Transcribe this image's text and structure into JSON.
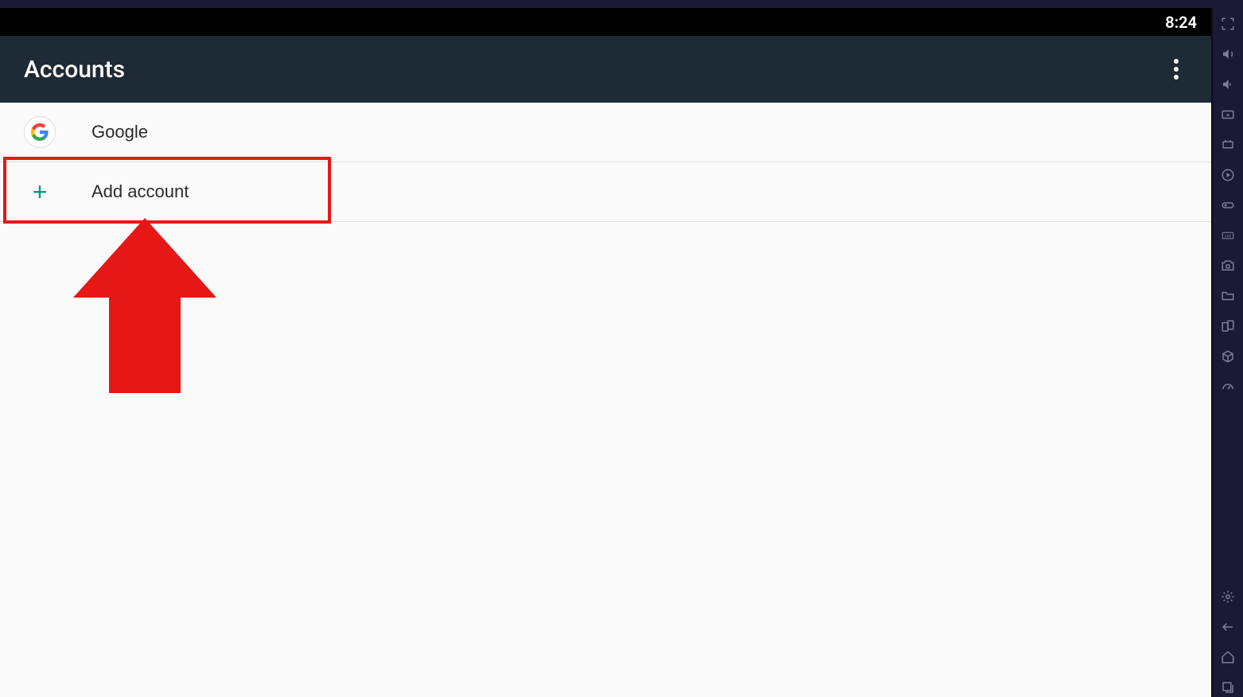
{
  "statusBar": {
    "time": "8:24"
  },
  "actionBar": {
    "title": "Accounts"
  },
  "accountItems": [
    {
      "label": "Google"
    },
    {
      "label": "Add account"
    }
  ]
}
